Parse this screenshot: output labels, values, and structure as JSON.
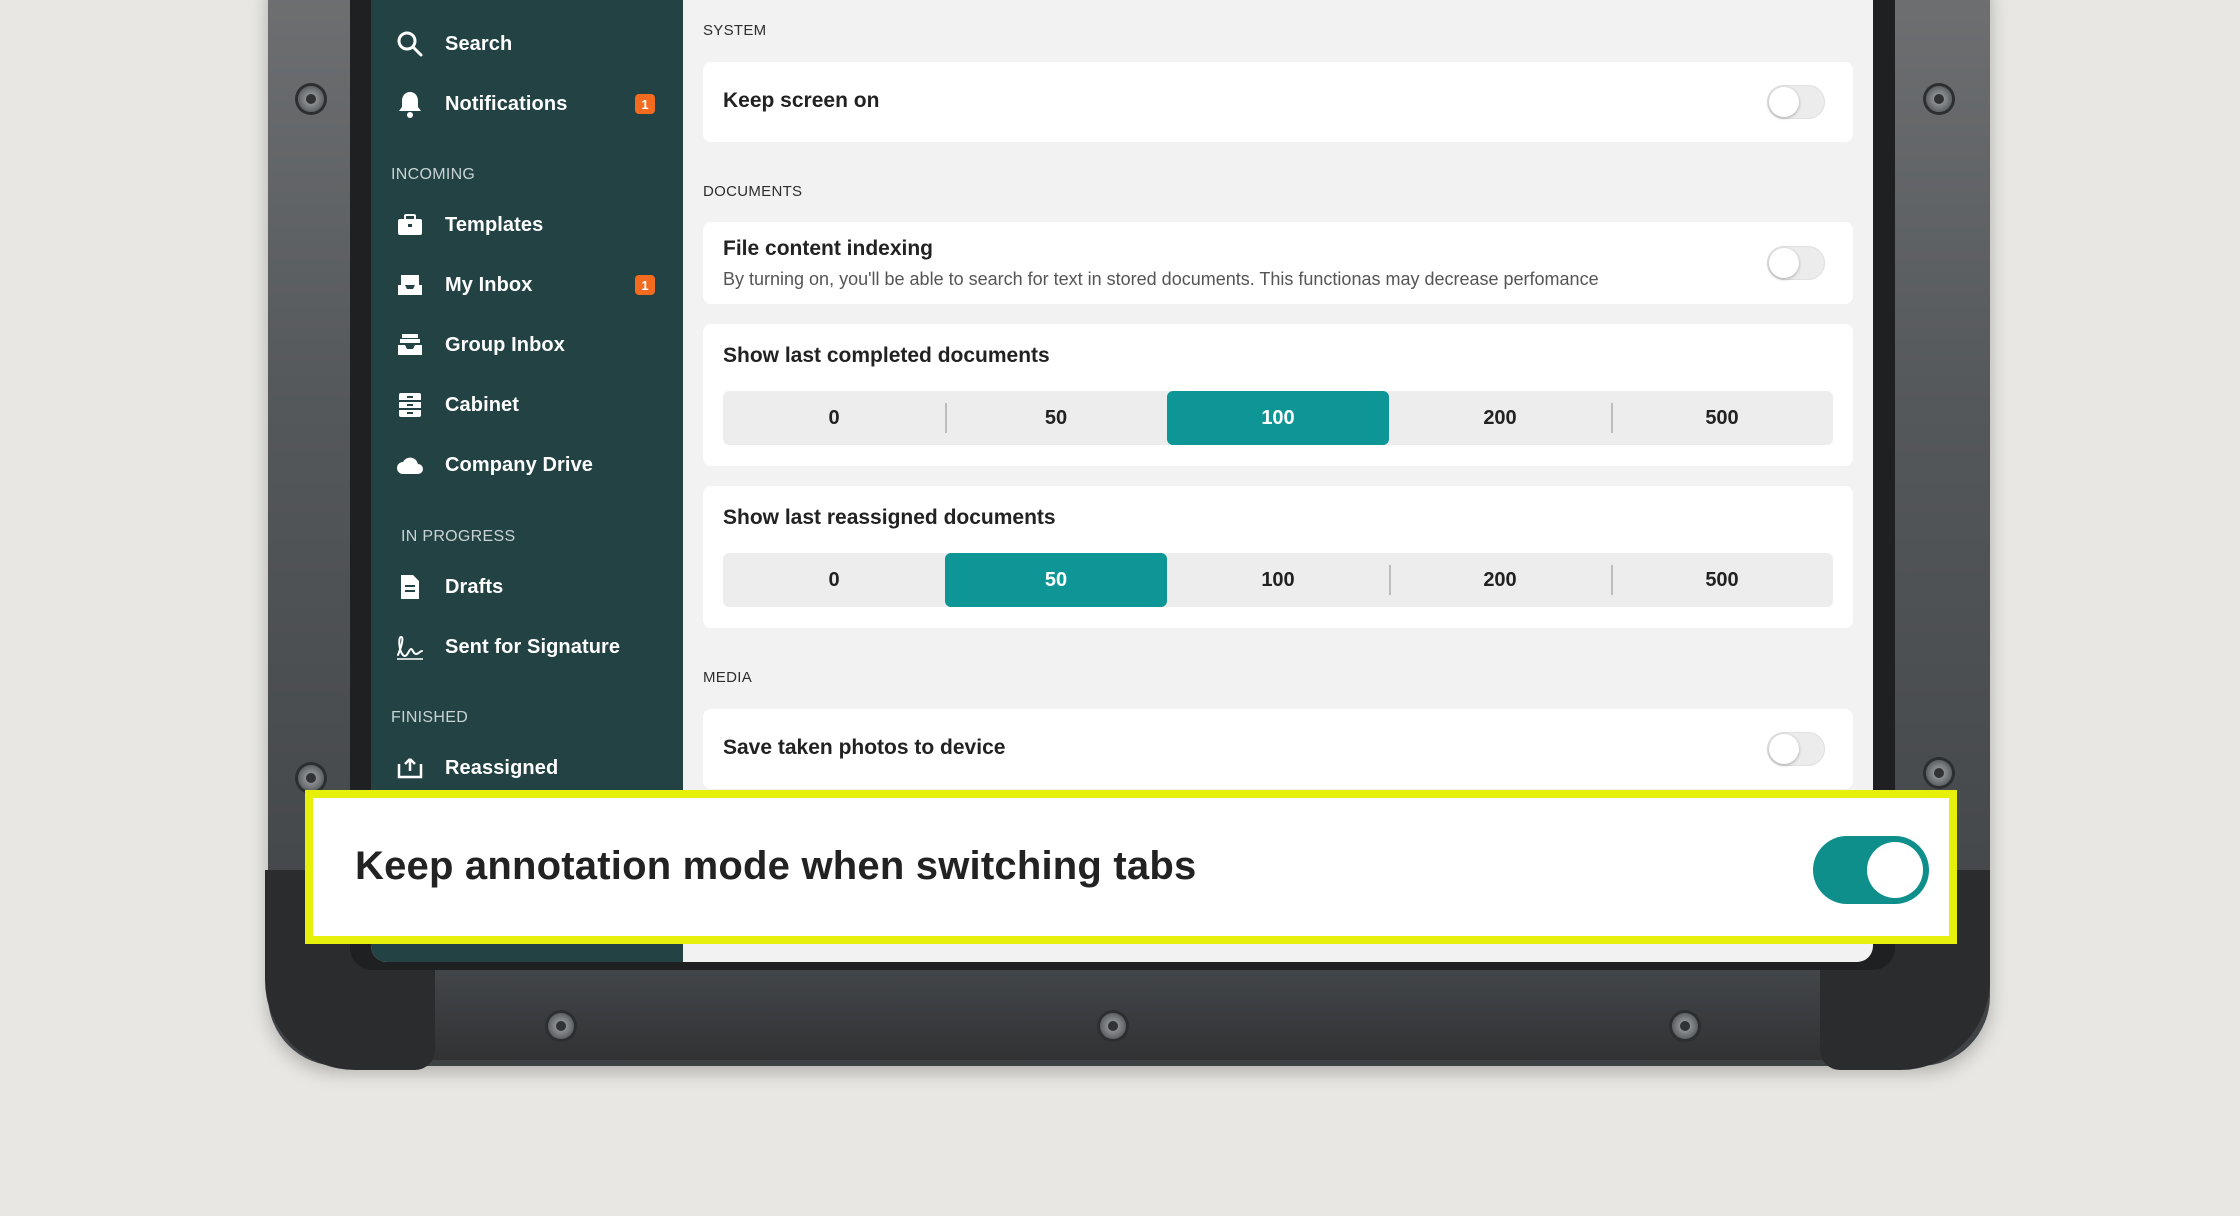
{
  "sidebar": {
    "search": "Search",
    "notifications": "Notifications",
    "notifications_badge": "1",
    "incoming_label": "INCOMING",
    "templates": "Templates",
    "my_inbox": "My Inbox",
    "my_inbox_badge": "1",
    "group_inbox": "Group Inbox",
    "cabinet": "Cabinet",
    "company_drive": "Company Drive",
    "in_progress_label": "IN PROGRESS",
    "drafts": "Drafts",
    "sent_for_signature": "Sent for Signature",
    "finished_label": "FINISHED",
    "reassigned": "Reassigned"
  },
  "settings": {
    "system_label": "SYSTEM",
    "keep_screen_on": "Keep screen on",
    "keep_screen_on_state": "off",
    "documents_label": "DOCUMENTS",
    "file_indexing": "File content indexing",
    "file_indexing_desc": "By turning on, you'll be able to search for text in stored documents. This functionas may decrease perfomance",
    "file_indexing_state": "off",
    "show_completed": "Show last completed documents",
    "completed_options": [
      "0",
      "50",
      "100",
      "200",
      "500"
    ],
    "completed_selected": "100",
    "show_reassigned": "Show last reassigned documents",
    "reassigned_options": [
      "0",
      "50",
      "100",
      "200",
      "500"
    ],
    "reassigned_selected": "50",
    "media_label": "MEDIA",
    "save_photos": "Save taken photos to device",
    "save_photos_state": "off"
  },
  "callout": {
    "text": "Keep annotation mode when switching tabs",
    "state": "on"
  },
  "colors": {
    "sidebar_bg": "#234244",
    "accent": "#0e9696",
    "badge": "#f26b1f",
    "highlight": "#e6f00a"
  }
}
